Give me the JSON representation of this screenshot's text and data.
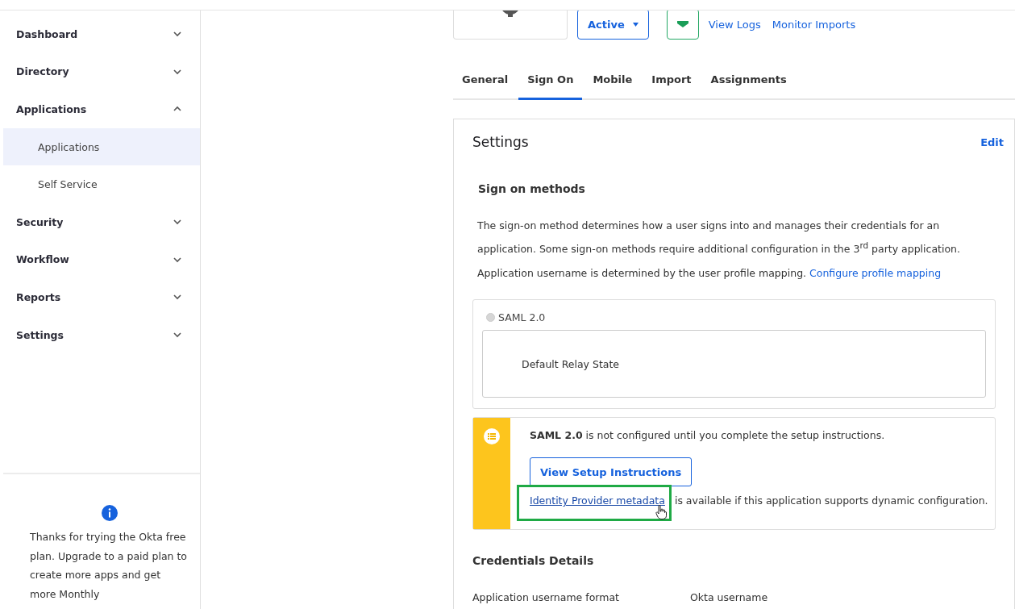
{
  "sidebar": {
    "items": [
      {
        "label": "Dashboard",
        "expanded": false
      },
      {
        "label": "Directory",
        "expanded": false
      },
      {
        "label": "Applications",
        "expanded": true,
        "children": [
          {
            "label": "Applications",
            "selected": true
          },
          {
            "label": "Self Service",
            "selected": false
          }
        ]
      },
      {
        "label": "Security",
        "expanded": false
      },
      {
        "label": "Workflow",
        "expanded": false
      },
      {
        "label": "Reports",
        "expanded": false
      },
      {
        "label": "Settings",
        "expanded": false
      }
    ],
    "promo": "Thanks for trying the Okta free plan. Upgrade to a paid plan to create more apps and get more Monthly"
  },
  "header": {
    "status": "Active",
    "links": [
      "View Logs",
      "Monitor Imports"
    ]
  },
  "tabs": [
    {
      "label": "General",
      "selected": false
    },
    {
      "label": "Sign On",
      "selected": true
    },
    {
      "label": "Mobile",
      "selected": false
    },
    {
      "label": "Import",
      "selected": false
    },
    {
      "label": "Assignments",
      "selected": false
    }
  ],
  "settings": {
    "title": "Settings",
    "edit": "Edit",
    "section_title": "Sign on methods",
    "description": "The sign-on method determines how a user signs into and manages their credentials for an application. Some sign-on methods require additional configuration in the 3$^{rd}$ party application.",
    "mapping_text": "Application username is determined by the user profile mapping.",
    "mapping_link": "Configure profile mapping",
    "method": {
      "label": "SAML 2.0",
      "selected": false
    },
    "relay_state": "Default Relay State",
    "notice": {
      "message": "**SAML 2.0** is not configured until you complete the setup instructions.",
      "button": "View Setup Instructions",
      "link": "Identity Provider metadata",
      "link_rest": "is available if this application supports dynamic configuration."
    },
    "credentials": {
      "title": "Credentials Details",
      "rows": [
        {
          "label": "Application username format",
          "value": "Okta username"
        }
      ]
    }
  }
}
